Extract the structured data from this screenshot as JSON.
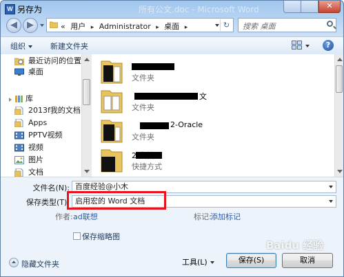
{
  "window": {
    "app_icon_letter": "W",
    "title": "另存为",
    "background_title": "所有公文.doc - Microsoft Word"
  },
  "nav": {
    "back_icon": "back-arrow-icon",
    "forward_icon": "forward-arrow-icon",
    "address": {
      "overflow": "«",
      "crumbs": [
        "用户",
        "Administrator",
        "桌面"
      ],
      "separator": "▸"
    },
    "search_placeholder": "搜索 桌面"
  },
  "toolbar": {
    "organize": "组织",
    "new_folder": "新建文件夹"
  },
  "sidebar": {
    "items": [
      {
        "label": "最近访问的位置",
        "icon": "recent-places-icon"
      },
      {
        "label": "桌面",
        "icon": "desktop-icon"
      },
      {
        "label": "库",
        "icon": "library-icon"
      },
      {
        "label": "2013f我的文档",
        "icon": "document-library-icon"
      },
      {
        "label": "Apps",
        "icon": "document-library-icon"
      },
      {
        "label": "PPTV视频",
        "icon": "video-library-icon"
      },
      {
        "label": "视频",
        "icon": "video-library-icon"
      },
      {
        "label": "图片",
        "icon": "picture-library-icon"
      },
      {
        "label": "文档",
        "icon": "document-library-icon"
      }
    ]
  },
  "files": [
    {
      "name": "",
      "type": "文件夹"
    },
    {
      "name": "文",
      "type": "文件夹"
    },
    {
      "name": "2-Oracle",
      "type": "文件夹"
    },
    {
      "name": "2 文档",
      "type": "快捷方式"
    }
  ],
  "form": {
    "filename_label": "文件名(N):",
    "filename_value": "百度经验@小木",
    "type_label": "保存类型(T):",
    "type_value": "启用宏的 Word 文档",
    "author_label": "作者:",
    "author_value": "ad联想",
    "tags_label": "标记:",
    "tags_value": "添加标记",
    "thumbnail_label": "保存缩略图",
    "thumbnail_checked": false,
    "hide_folders": "隐藏文件夹",
    "tools": "工具(L)",
    "save": "保存(S)",
    "cancel": "取消"
  },
  "watermark": "Baidu 经验",
  "colors": {
    "highlight_box": "#e8131b",
    "link": "#2a5db0",
    "close_button": "#c7432e"
  }
}
